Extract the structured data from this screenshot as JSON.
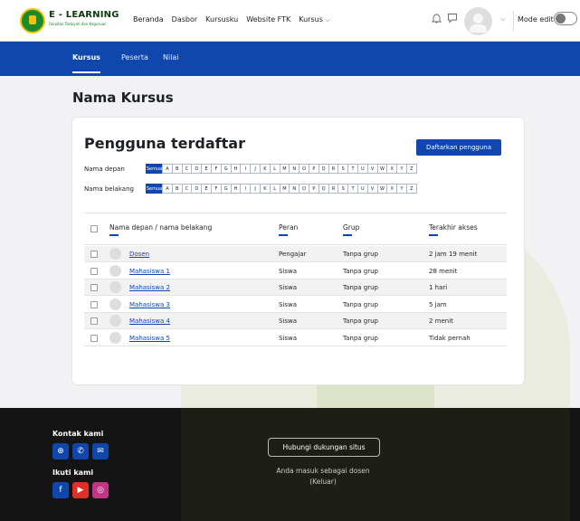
{
  "brand": {
    "title": "E - LEARNING",
    "subtitle": "Fakultas Tarbiyah dan Keguruan"
  },
  "nav": {
    "items": [
      "Beranda",
      "Dasbor",
      "Kursusku",
      "Website FTK",
      "Kursus"
    ]
  },
  "header": {
    "mode_label": "Mode edit",
    "mode_on": false
  },
  "subnav": {
    "tabs": [
      "Kursus",
      "Peserta",
      "Nilai"
    ],
    "active": "Kursus"
  },
  "page": {
    "title": "Nama Kursus"
  },
  "card": {
    "title": "Pengguna terdaftar",
    "enroll_button": "Daftarkan pengguna",
    "filters": {
      "first_label": "Nama depan",
      "last_label": "Nama belakang",
      "all": "Semua",
      "letters": [
        "A",
        "B",
        "C",
        "D",
        "E",
        "F",
        "G",
        "H",
        "I",
        "J",
        "K",
        "L",
        "M",
        "N",
        "O",
        "P",
        "Q",
        "R",
        "S",
        "T",
        "U",
        "V",
        "W",
        "X",
        "Y",
        "Z"
      ]
    },
    "table": {
      "headers": [
        "Nama depan / nama belakang",
        "Peran",
        "Grup",
        "Terakhir akses"
      ],
      "rows": [
        {
          "name": "Dosen",
          "role": "Pengajar",
          "group": "Tanpa grup",
          "last": "2 jam 19 menit"
        },
        {
          "name": "Mahasiswa 1",
          "role": "Siswa",
          "group": "Tanpa grup",
          "last": "28 menit"
        },
        {
          "name": "Mahasiswa 2",
          "role": "Siswa",
          "group": "Tanpa grup",
          "last": "1 hari"
        },
        {
          "name": "Mahasiswa 3",
          "role": "Siswa",
          "group": "Tanpa grup",
          "last": "5 jam"
        },
        {
          "name": "Mahasiswa 4",
          "role": "Siswa",
          "group": "Tanpa grup",
          "last": "2 menit"
        },
        {
          "name": "Mahasiswa 5",
          "role": "Siswa",
          "group": "Tanpa grup",
          "last": "Tidak pernah"
        }
      ]
    }
  },
  "footer": {
    "contact_heading": "Kontak kami",
    "follow_heading": "Ikuti kami",
    "support_button": "Hubungi dukungan situs",
    "login_text": "Anda masuk sebagai dosen",
    "logout_text": "(Keluar)"
  },
  "colors": {
    "primary": "#0f47ad",
    "footer_bg": "#141414"
  }
}
